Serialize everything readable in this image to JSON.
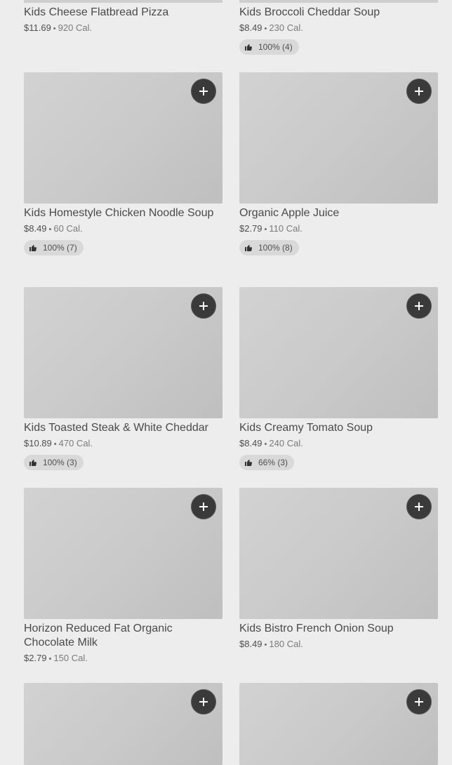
{
  "items": [
    {
      "name": "Kids Cheese Flatbread Pizza",
      "price": "$11.69",
      "cal": "920 Cal.",
      "rating": null
    },
    {
      "name": "Kids Broccoli Cheddar Soup",
      "price": "$8.49",
      "cal": "230 Cal.",
      "rating": "100% (4)"
    },
    {
      "name": "Kids Homestyle Chicken Noodle Soup",
      "price": "$8.49",
      "cal": "60 Cal.",
      "rating": "100% (7)"
    },
    {
      "name": "Organic Apple Juice",
      "price": "$2.79",
      "cal": "110 Cal.",
      "rating": "100% (8)"
    },
    {
      "name": "Kids Toasted Steak & White Cheddar",
      "price": "$10.89",
      "cal": "470 Cal.",
      "rating": "100% (3)"
    },
    {
      "name": "Kids Creamy Tomato Soup",
      "price": "$8.49",
      "cal": "240 Cal.",
      "rating": "66% (3)"
    },
    {
      "name": "Horizon Reduced Fat Organic Chocolate Milk",
      "price": "$2.79",
      "cal": "150 Cal.",
      "rating": null
    },
    {
      "name": "Kids Bistro French Onion Soup",
      "price": "$8.49",
      "cal": "180 Cal.",
      "rating": null
    },
    {
      "name": "",
      "price": "",
      "cal": "",
      "rating": null
    },
    {
      "name": "",
      "price": "",
      "cal": "",
      "rating": null
    }
  ],
  "separator": "•",
  "icons": {
    "add": "plus-icon",
    "rating": "thumbs-up-icon"
  },
  "colors": {
    "background": "#ededed",
    "add_button": "#3a3a3a",
    "rating_pill": "#d9d9d9"
  }
}
